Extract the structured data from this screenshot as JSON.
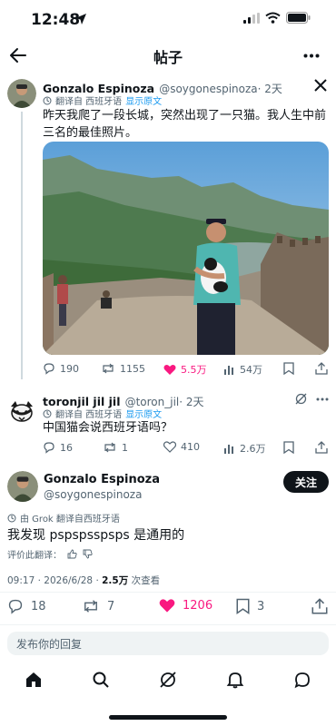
{
  "status_bar": {
    "time": "12:48"
  },
  "nav": {
    "title": "帖子"
  },
  "original_post": {
    "name": "Gonzalo Espinoza",
    "handle": "@soygonespinoza",
    "time": "· 2天",
    "translated_from": "翻译自 西班牙语",
    "show_original": "显示原文",
    "text": "昨天我爬了一段长城，突然出现了一只猫。我人生中前三名的最佳照片。",
    "stats": {
      "replies": "190",
      "reposts": "1155",
      "likes": "5.5万",
      "views": "54万"
    }
  },
  "reply_post": {
    "name": "toronjil jil jil",
    "handle": "@toron_jil",
    "time": "· 2天",
    "translated_from": "翻译自 西班牙语",
    "show_original": "显示原文",
    "text": "中国猫会说西班牙语吗？",
    "stats": {
      "replies": "16",
      "reposts": "1",
      "likes": "410",
      "views": "2.6万"
    }
  },
  "main_post": {
    "name": "Gonzalo Espinoza",
    "handle": "@soygonespinoza",
    "follow_label": "关注",
    "grok_translated": "由 Grok 翻译自西班牙语",
    "text": "我发现 pspspsspsps 是通用的",
    "rate_translation": "评价此翻译：",
    "timestamp": "09:17 · 2026/6/28 · ",
    "views_count": "2.5万",
    "views_label": " 次查看",
    "stats": {
      "replies": "18",
      "reposts": "7",
      "likes": "1206",
      "bookmarks": "3"
    }
  },
  "reply_input": {
    "placeholder": "发布你的回复"
  },
  "colors": {
    "like": "#f91880",
    "accent": "#1d9bf0",
    "text": "#0f1419",
    "muted": "#536471"
  },
  "bottom_nav": [
    "home-icon",
    "search-icon",
    "grok-icon",
    "notifications-icon",
    "messages-icon"
  ]
}
